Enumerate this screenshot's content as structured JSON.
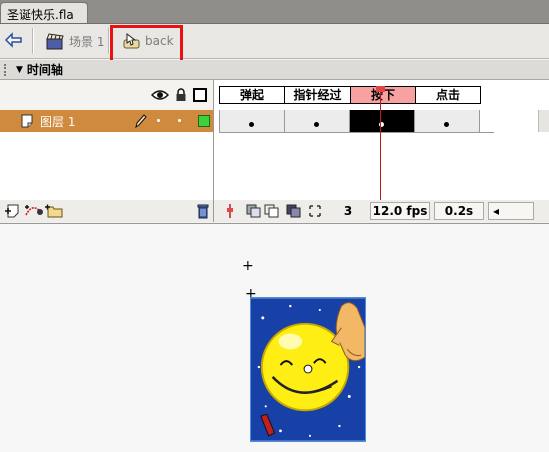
{
  "window": {
    "doc_tab": "圣诞快乐.fla"
  },
  "breadcrumb": {
    "back_icon": "arrow-left-icon",
    "scene_label": "场景 1",
    "scene_icon": "clapperboard-icon",
    "symbol_label": "back",
    "symbol_icon": "button-symbol-icon"
  },
  "timeline": {
    "panel_title": "时间轴",
    "header_icons": [
      "eye-icon",
      "lock-icon",
      "outline-icon"
    ],
    "layer": {
      "name": "图层 1",
      "outline_color": "#3dd23d"
    },
    "frames": [
      {
        "label": "弹起",
        "keyframe": true,
        "current": false
      },
      {
        "label": "指针经过",
        "keyframe": true,
        "current": false
      },
      {
        "label": "按下",
        "keyframe": true,
        "current": true
      },
      {
        "label": "点击",
        "keyframe": true,
        "current": false
      }
    ],
    "current_frame": "3",
    "fps": "12.0 fps",
    "elapsed": "0.2s",
    "playhead_color": "#c31919",
    "layer_color": "#cf8a3e"
  },
  "highlight_color": "#e81212"
}
